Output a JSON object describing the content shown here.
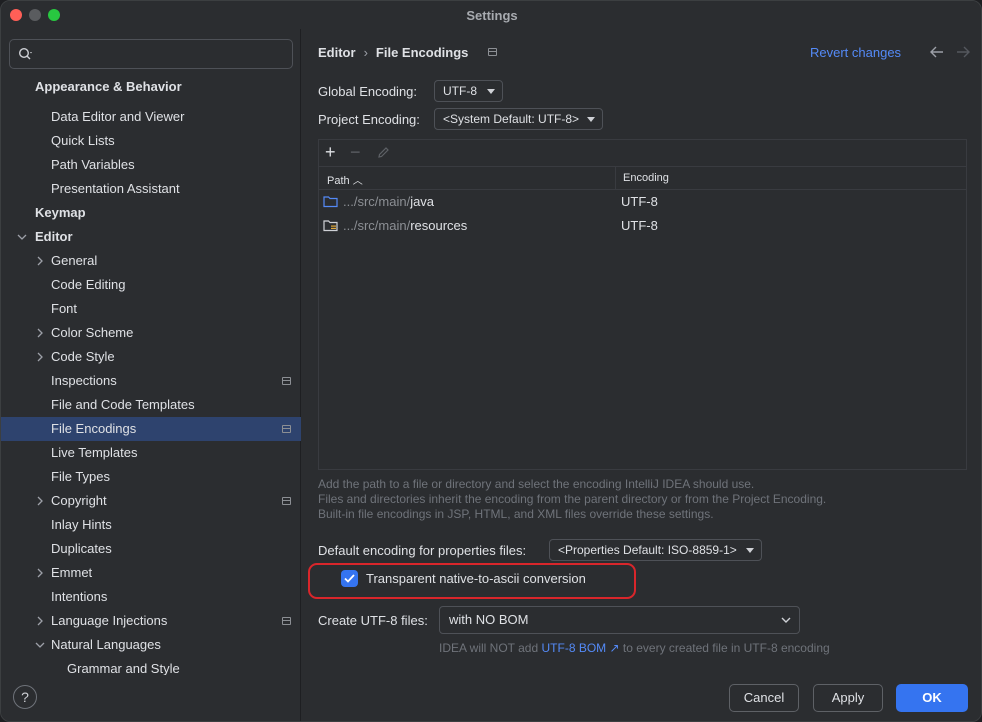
{
  "window": {
    "title": "Settings"
  },
  "search": {
    "placeholder": ""
  },
  "sidebar": {
    "items": [
      {
        "label": "Appearance & Behavior",
        "bold": true
      },
      {
        "label": "Data Editor and Viewer"
      },
      {
        "label": "Quick Lists"
      },
      {
        "label": "Path Variables"
      },
      {
        "label": "Presentation Assistant"
      },
      {
        "label": "Keymap",
        "bold": true
      },
      {
        "label": "Editor",
        "bold": true
      },
      {
        "label": "General"
      },
      {
        "label": "Code Editing"
      },
      {
        "label": "Font"
      },
      {
        "label": "Color Scheme"
      },
      {
        "label": "Code Style"
      },
      {
        "label": "Inspections"
      },
      {
        "label": "File and Code Templates"
      },
      {
        "label": "File Encodings"
      },
      {
        "label": "Live Templates"
      },
      {
        "label": "File Types"
      },
      {
        "label": "Copyright"
      },
      {
        "label": "Inlay Hints"
      },
      {
        "label": "Duplicates"
      },
      {
        "label": "Emmet"
      },
      {
        "label": "Intentions"
      },
      {
        "label": "Language Injections"
      },
      {
        "label": "Natural Languages"
      },
      {
        "label": "Grammar and Style"
      }
    ]
  },
  "header": {
    "breadcrumb_parent": "Editor",
    "breadcrumb_current": "File Encodings",
    "revert_label": "Revert changes"
  },
  "global_encoding": {
    "label": "Global Encoding:",
    "value": "UTF-8"
  },
  "project_encoding": {
    "label": "Project Encoding:",
    "value": "<System Default: UTF-8>"
  },
  "table": {
    "columns": [
      "Path",
      "Encoding"
    ],
    "rows": [
      {
        "path_prefix": ".../src/main/",
        "path_name": "java",
        "encoding": "UTF-8"
      },
      {
        "path_prefix": ".../src/main/",
        "path_name": "resources",
        "encoding": "UTF-8"
      }
    ]
  },
  "hints": {
    "line1": "Add the path to a file or directory and select the encoding IntelliJ IDEA should use.",
    "line2": "Files and directories inherit the encoding from the parent directory or from the Project Encoding.",
    "line3": "Built-in file encodings in JSP, HTML, and XML files override these settings."
  },
  "properties_encoding": {
    "label": "Default encoding for properties files:",
    "value": "<Properties Default: ISO-8859-1>"
  },
  "native_to_ascii": {
    "label": "Transparent native-to-ascii conversion",
    "checked": true
  },
  "create_utf8": {
    "label": "Create UTF-8 files:",
    "value": "with NO BOM",
    "note_before": "IDEA will NOT add",
    "note_link": "UTF-8 BOM",
    "note_after": "to every created file in UTF-8 encoding"
  },
  "footer": {
    "help": "?",
    "cancel": "Cancel",
    "apply": "Apply",
    "ok": "OK"
  },
  "colors": {
    "accent": "#3574f0",
    "selection": "#2e436e",
    "link": "#548af7",
    "highlight": "#d9262b"
  }
}
